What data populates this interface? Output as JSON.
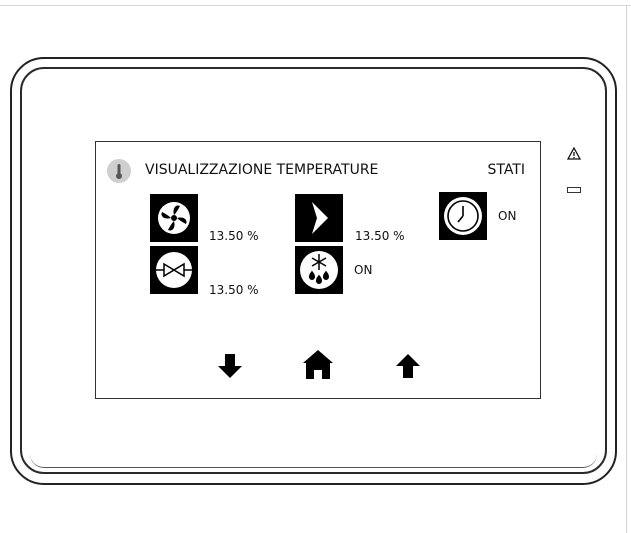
{
  "screen": {
    "title": "VISUALIZZAZIONE TEMPERATURE",
    "section_label": "STATI",
    "header_icon": "thermometer-icon"
  },
  "indicators": {
    "fan": {
      "icon": "fan-icon",
      "value": "13.50 %"
    },
    "damper": {
      "icon": "damper-chevron-icon",
      "value": "13.50 %"
    },
    "timer": {
      "icon": "clock-icon",
      "value": "ON"
    },
    "valve": {
      "icon": "valve-icon",
      "value": "13.50 %"
    },
    "defrost": {
      "icon": "defrost-snowflake-icon",
      "value": "ON"
    }
  },
  "nav": {
    "down": "arrow-down-icon",
    "home": "home-icon",
    "up": "arrow-up-icon"
  },
  "device": {
    "warning_icon": "warning-triangle-icon",
    "status_led": "status-led"
  },
  "colors": {
    "icon_fg": "#000000",
    "screen_bg": "#ffffff",
    "badge": "#cfcfcf"
  }
}
